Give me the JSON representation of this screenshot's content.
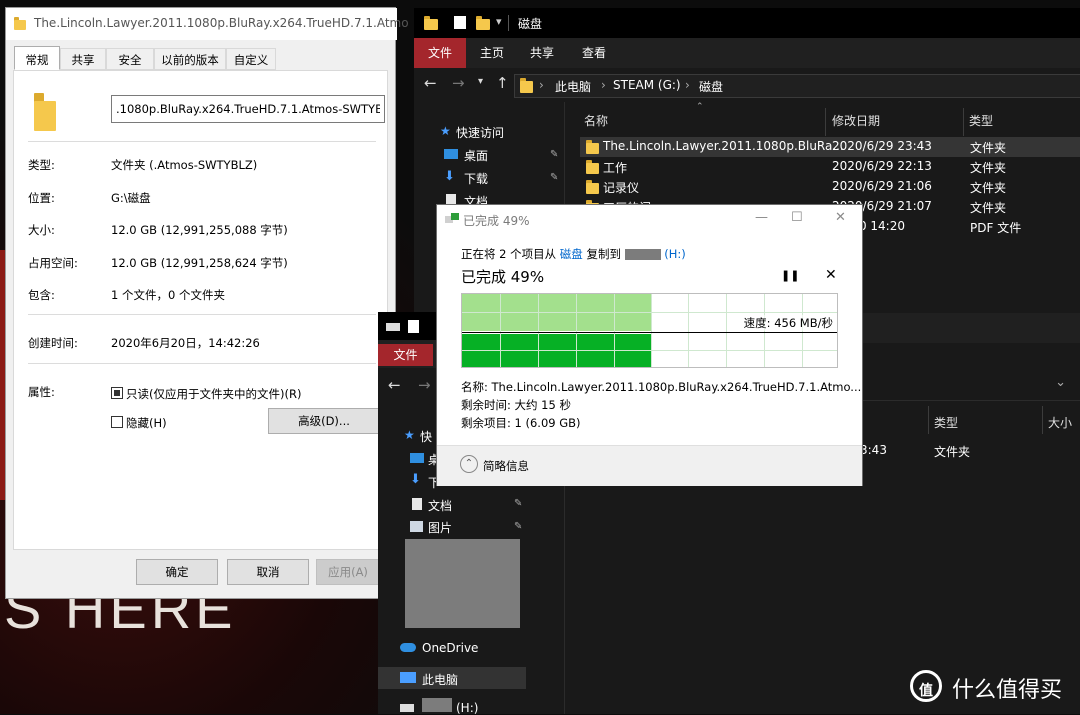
{
  "wallpaper": {
    "text": "S HERE"
  },
  "properties": {
    "title": "The.Lincoln.Lawyer.2011.1080p.BluRay.x264.TrueHD.7.1.Atmo",
    "tabs": [
      "常规",
      "共享",
      "安全",
      "以前的版本",
      "自定义"
    ],
    "name_value": ".1080p.BluRay.x264.TrueHD.7.1.Atmos-SWTYBLZ",
    "rows": [
      {
        "label": "类型:",
        "value": "文件夹 (.Atmos-SWTYBLZ)"
      },
      {
        "label": "位置:",
        "value": "G:\\磁盘"
      },
      {
        "label": "大小:",
        "value": "12.0 GB (12,991,255,088 字节)"
      },
      {
        "label": "占用空间:",
        "value": "12.0 GB (12,991,258,624 字节)"
      },
      {
        "label": "包含:",
        "value": "1 个文件，0 个文件夹"
      },
      {
        "label": "创建时间:",
        "value": "2020年6月20日，14:42:26"
      }
    ],
    "attr_label": "属性:",
    "readonly_label": "只读(仅应用于文件夹中的文件)(R)",
    "readonly_checked": true,
    "hidden_label": "隐藏(H)",
    "hidden_checked": false,
    "advanced_label": "高级(D)...",
    "ok_label": "确定",
    "cancel_label": "取消",
    "apply_label": "应用(A)"
  },
  "explorer_back": {
    "title": "磁盘",
    "ribbon_tabs": [
      "文件",
      "主页",
      "共享",
      "查看"
    ],
    "breadcrumb": [
      "此电脑",
      "STEAM (G:)",
      "磁盘"
    ],
    "columns": {
      "name": "名称",
      "date": "修改日期",
      "type": "类型"
    },
    "nav": [
      {
        "label": "快速访问",
        "icon": "star-icon"
      },
      {
        "label": "桌面",
        "icon": "desktop-icon"
      },
      {
        "label": "下载",
        "icon": "download-icon"
      },
      {
        "label": "文档",
        "icon": "document-icon"
      }
    ],
    "files": [
      {
        "name": "The.Lincoln.Lawyer.2011.1080p.BluRa...",
        "date": "2020/6/29 23:43",
        "type": "文件夹",
        "selected": true
      },
      {
        "name": "工作",
        "date": "2020/6/29 22:13",
        "type": "文件夹"
      },
      {
        "name": "记录仪",
        "date": "2020/6/29 21:06",
        "type": "文件夹"
      },
      {
        "name": "工厂的门",
        "date": "2020/6/29 21:07",
        "type": "文件夹"
      },
      {
        "name": "",
        "date": "10/30 14:20",
        "type": "PDF 文件"
      }
    ],
    "lower_columns": {
      "type": "类型",
      "size": "大小"
    },
    "lower_row": {
      "date": "3:43",
      "type": "文件夹"
    }
  },
  "copy_dialog": {
    "title": "已完成 49%",
    "line1_prefix": "正在将 2 个项目从",
    "line1_source": "磁盘",
    "line1_mid": "复制到",
    "line1_dest": "(H:)",
    "progress_text": "已完成 49%",
    "progress": 0.49,
    "speed": "速度: 456 MB/秒",
    "name_line": "名称: The.Lincoln.Lawyer.2011.1080p.BluRay.x264.TrueHD.7.1.Atmo...",
    "remaining_time": "剩余时间: 大约 15 秒",
    "remaining_items": "剩余项目: 1 (6.09 GB)",
    "collapse_label": "简略信息",
    "colors": {
      "fill_light": "#a3e08d",
      "fill_dark": "#06b025"
    }
  },
  "explorer_front": {
    "file_tab": "文件",
    "nav": [
      {
        "label": "快",
        "icon": "star-icon"
      },
      {
        "label": "桌",
        "icon": "desktop-icon"
      },
      {
        "label": "下",
        "icon": "download-icon"
      },
      {
        "label": "文档",
        "icon": "document-icon"
      },
      {
        "label": "图片",
        "icon": "picture-icon"
      },
      {
        "label": "OneDrive",
        "icon": "cloud-icon"
      },
      {
        "label": "此电脑",
        "icon": "computer-icon"
      },
      {
        "label": "(H:)",
        "icon": "drive-icon"
      }
    ]
  },
  "watermark": {
    "text": "什么值得买",
    "logo": "值"
  }
}
